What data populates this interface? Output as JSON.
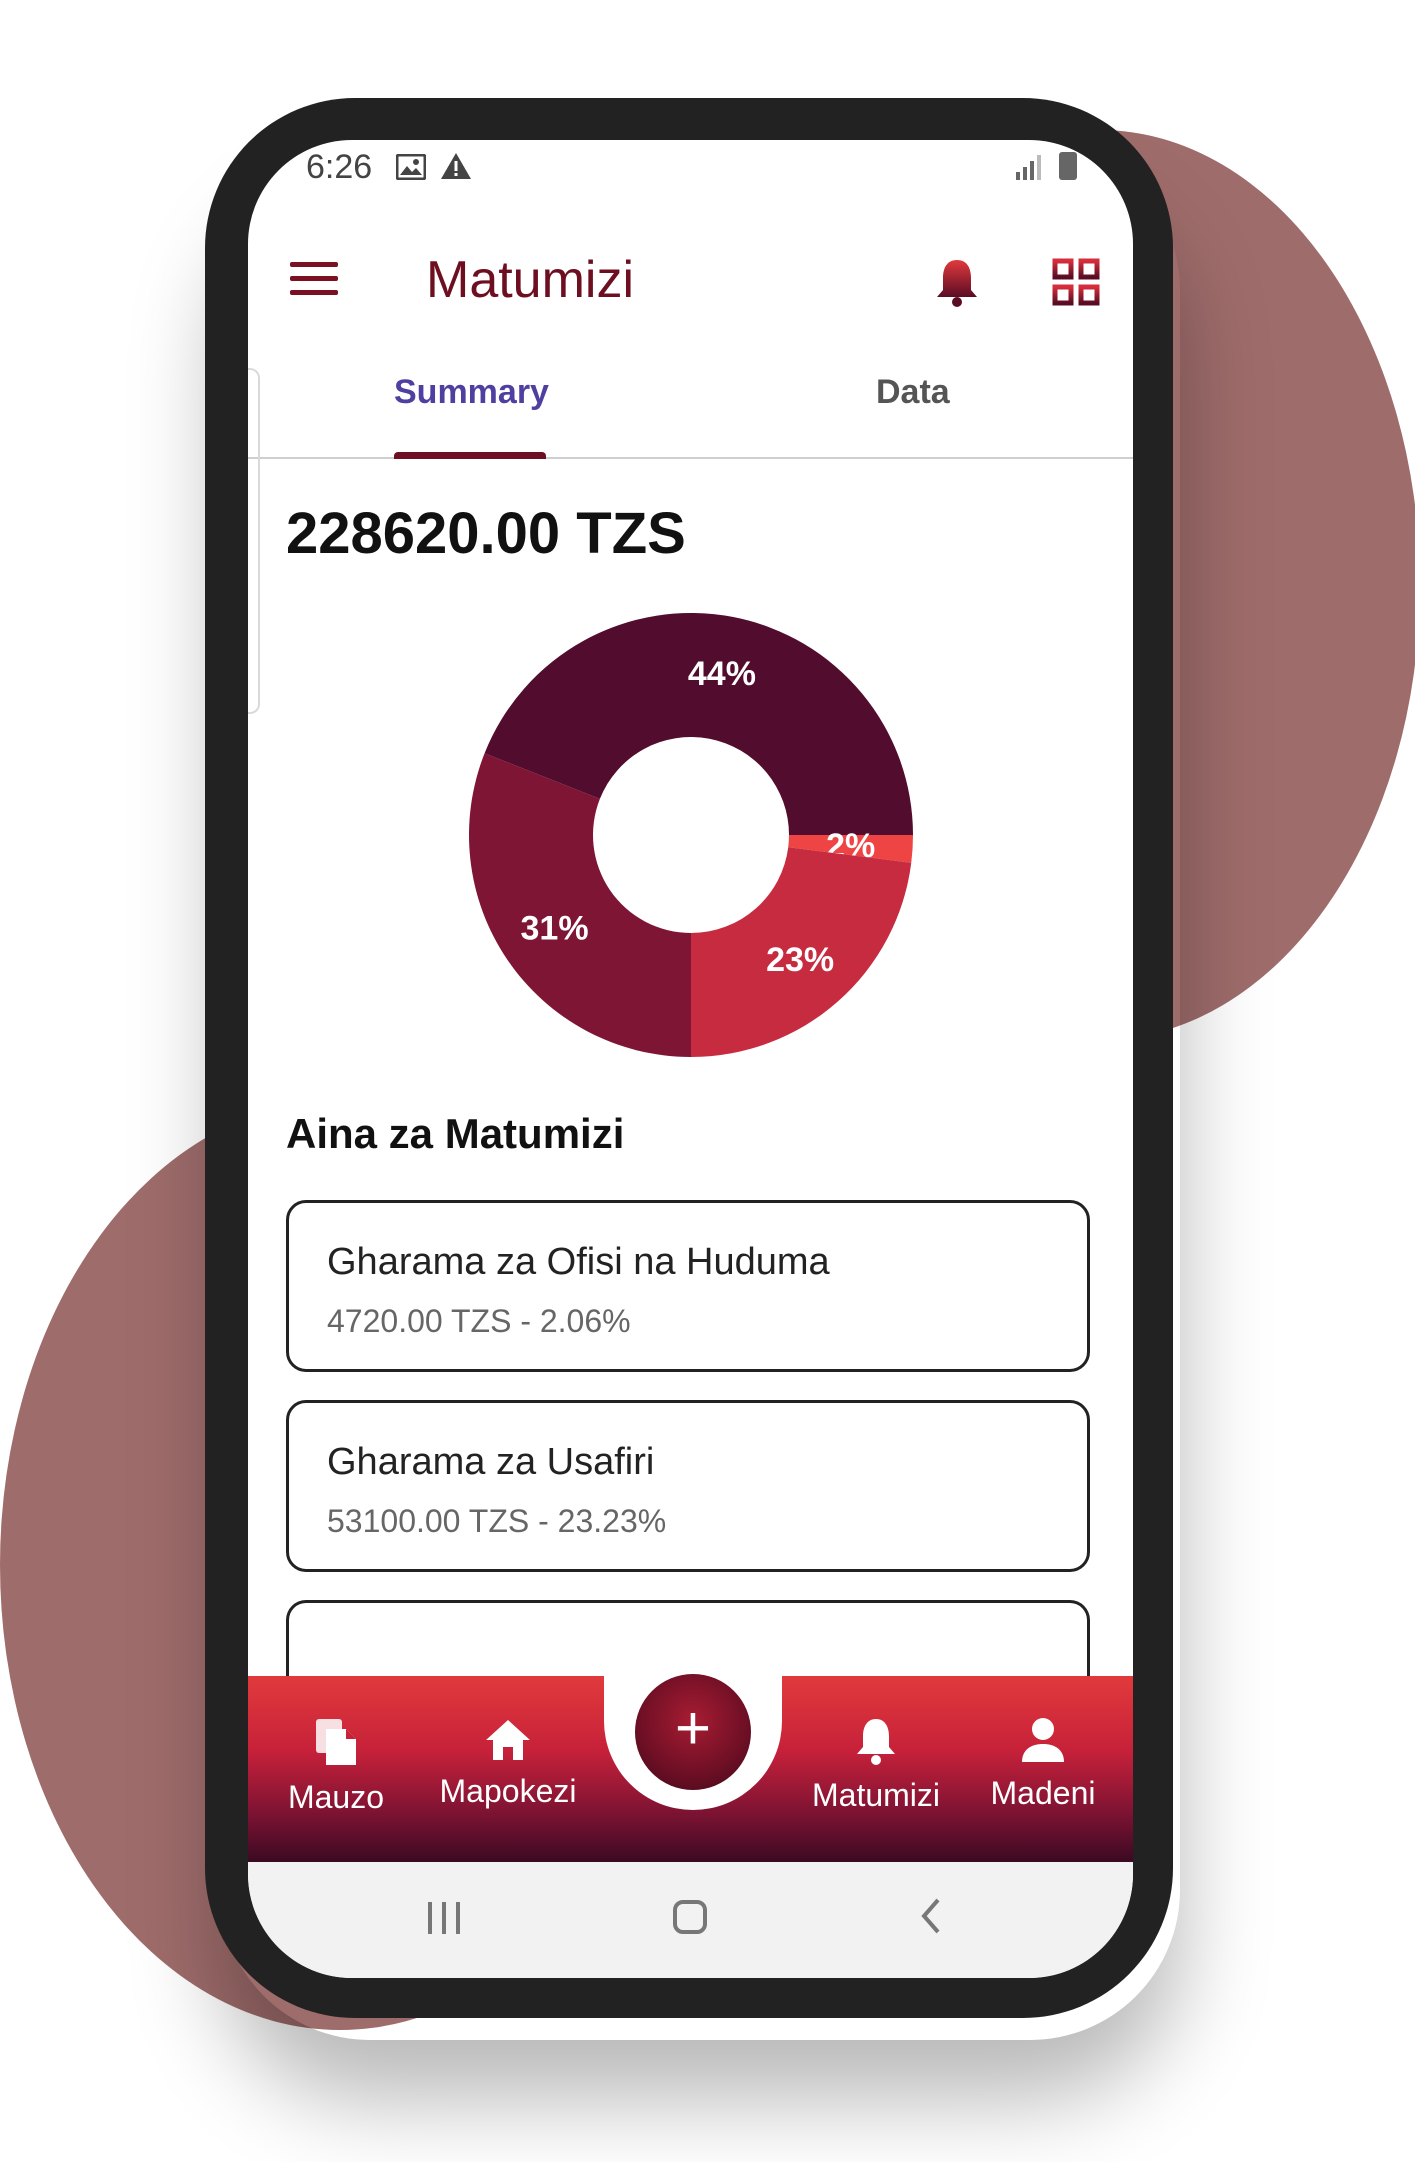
{
  "colors": {
    "brand": "#6d0f21",
    "tab_active_text": "#4f3fa0",
    "accent_red": "#e13a3c",
    "background_blob": "#9e6c6b"
  },
  "status_bar": {
    "time": "6:26",
    "icons": [
      "image-icon",
      "warning-icon",
      "signal-icon",
      "battery-icon"
    ]
  },
  "app_bar": {
    "title": "Matumizi",
    "icons": [
      "menu-icon",
      "bell-icon",
      "grid-icon"
    ]
  },
  "tabs": [
    {
      "label": "Summary",
      "active": true
    },
    {
      "label": "Data",
      "active": false
    }
  ],
  "summary": {
    "total": "228620.00 TZS"
  },
  "chart_data": {
    "type": "pie",
    "donut": true,
    "slices": [
      {
        "label": "44%",
        "value": 44,
        "color": "#520c2e"
      },
      {
        "label": "2%",
        "value": 2,
        "color": "#ee4444"
      },
      {
        "label": "23%",
        "value": 23,
        "color": "#c72b40"
      },
      {
        "label": "31%",
        "value": 31,
        "color": "#7f1534"
      }
    ]
  },
  "section": {
    "title": "Aina za Matumizi"
  },
  "categories": [
    {
      "name": "Gharama za Ofisi na Huduma",
      "detail": "4720.00 TZS - 2.06%"
    },
    {
      "name": "Gharama za Usafiri",
      "detail": "53100.00 TZS - 23.23%"
    }
  ],
  "bottom_nav": [
    {
      "label": "Mauzo",
      "icon": "file-icon"
    },
    {
      "label": "Mapokezi",
      "icon": "home-icon"
    },
    {
      "label": "Matumizi",
      "icon": "bell-icon"
    },
    {
      "label": "Madeni",
      "icon": "person-icon"
    }
  ],
  "fab": {
    "icon": "plus-icon",
    "symbol": "+"
  }
}
